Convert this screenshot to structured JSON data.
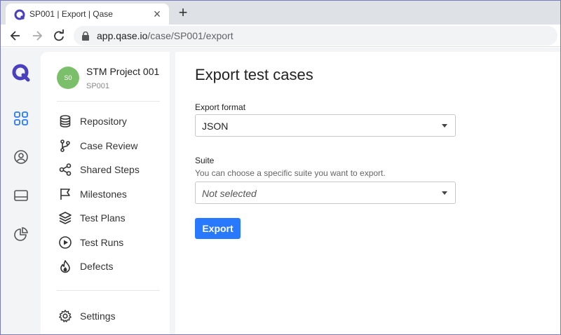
{
  "browser": {
    "tab_title": "SP001 | Export | Qase",
    "close_glyph": "×",
    "new_tab_glyph": "+",
    "url_host": "app.qase.io",
    "url_path": "/case/SP001/export"
  },
  "rail": {
    "icons": [
      "qase-logo-icon",
      "dashboard-grid-icon",
      "user-circle-icon",
      "inbox-tray-icon",
      "pie-chart-icon"
    ]
  },
  "project": {
    "avatar_initials": "S0",
    "name": "STM Project 001",
    "code": "SP001",
    "avatar_color": "#7bbf6a"
  },
  "sidebar": {
    "items": [
      {
        "label": "Repository",
        "icon": "database-icon"
      },
      {
        "label": "Case Review",
        "icon": "git-branch-icon"
      },
      {
        "label": "Shared Steps",
        "icon": "share-nodes-icon"
      },
      {
        "label": "Milestones",
        "icon": "flag-icon"
      },
      {
        "label": "Test Plans",
        "icon": "layers-icon"
      },
      {
        "label": "Test Runs",
        "icon": "play-circle-icon"
      },
      {
        "label": "Defects",
        "icon": "fire-icon"
      }
    ],
    "settings_label": "Settings"
  },
  "main": {
    "title": "Export test cases",
    "format": {
      "label": "Export format",
      "value": "JSON"
    },
    "suite": {
      "label": "Suite",
      "help": "You can choose a specific suite you want to export.",
      "placeholder": "Not selected"
    },
    "export_label": "Export"
  },
  "colors": {
    "accent": "#2979ff",
    "brand": "#4a3fbf"
  }
}
